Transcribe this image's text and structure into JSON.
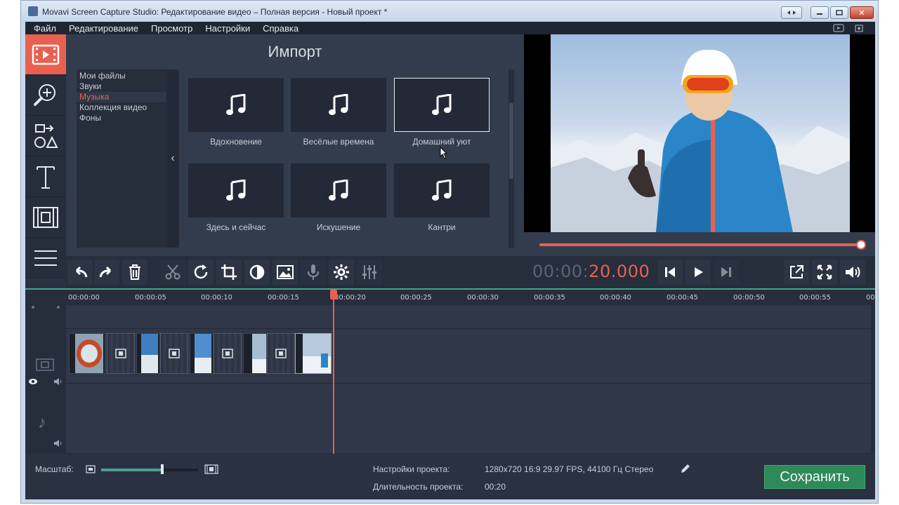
{
  "window": {
    "title": "Movavi Screen Capture Studio: Редактирование видео – Полная версия - Новый проект *",
    "min_label": "▭",
    "max_label": "□",
    "close_label": "✕"
  },
  "menu": [
    "Файл",
    "Редактирование",
    "Просмотр",
    "Настройки",
    "Справка"
  ],
  "import": {
    "title": "Импорт",
    "categories": [
      "Мои файлы",
      "Звуки",
      "Музыка",
      "Коллекция видео",
      "Фоны"
    ],
    "selected_category": "Музыка",
    "collapse_label": "‹",
    "tiles": [
      "Вдохновение",
      "Весёлые времена",
      "Домашний уют",
      "Здесь и сейчас",
      "Искушение",
      "Кантри"
    ],
    "tile_glyph": "♫",
    "selected_tile": "Домашний уют"
  },
  "preview": {
    "timecode_main": "00:00:",
    "timecode_accent": "20.000",
    "progress": 1.0
  },
  "timeline": {
    "ruler": [
      "00:00:00",
      "00:00:05",
      "00:00:10",
      "00:00:15",
      "00:00:20",
      "00:00:25",
      "00:00:30",
      "00:00:35",
      "00:00:40",
      "00:00:45",
      "00:00:50",
      "00:00:55",
      "00"
    ],
    "music_note": "♪"
  },
  "bottom": {
    "zoom_label": "Масштаб:",
    "zoom_value": 0.63,
    "settings_label": "Настройки проекта:",
    "settings_value": "1280x720 16:9 29.97 FPS, 44100 Гц Стерео",
    "duration_label": "Длительность проекта:",
    "duration_value": "00:20",
    "save_label": "Сохранить"
  },
  "colors": {
    "accent": "#e86150",
    "save_green": "#2e8a5a",
    "panel": "#333c4d"
  }
}
